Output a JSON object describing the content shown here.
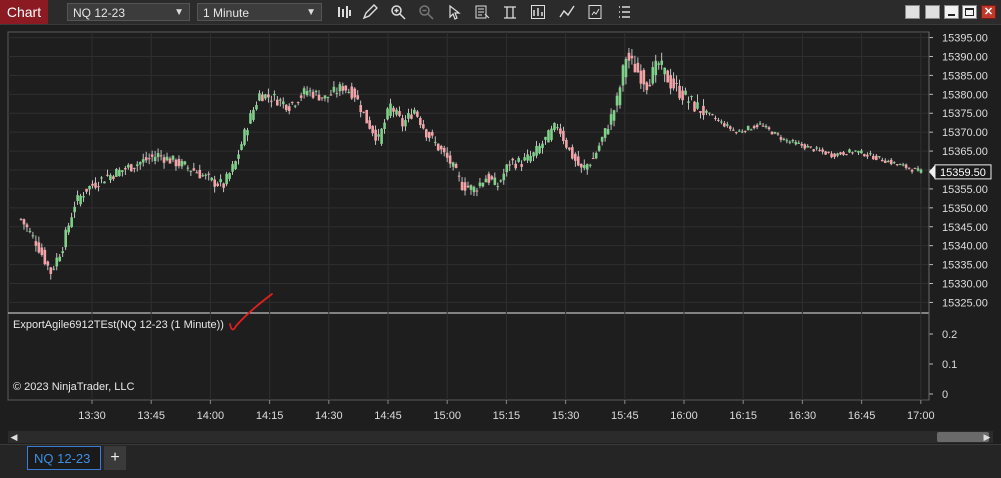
{
  "toolbar": {
    "title": "Chart",
    "instrument": "NQ 12-23",
    "interval": "1 Minute",
    "tools": [
      "bar-style-icon",
      "draw-pencil-icon",
      "zoom-in-icon",
      "zoom-out-icon",
      "pointer-icon",
      "data-box-icon",
      "template-icon",
      "strategies-icon",
      "indicators-icon",
      "properties-icon",
      "menu-icon"
    ]
  },
  "price_axis": {
    "current_price": "15359.50"
  },
  "indicator": {
    "label": "ExportAgile6912TEst(NQ 12-23 (1 Minute))",
    "copyright": "© 2023 NinjaTrader, LLC"
  },
  "tabs": {
    "active": "NQ 12-23",
    "add": "+"
  },
  "colors": {
    "background": "#1e1e1e",
    "up_candle": "#7fd18a",
    "down_candle": "#f2a3a8",
    "wick": "#e8e8e8",
    "accent": "#8b1a22",
    "annotation": "#e02020"
  },
  "chart_data": {
    "type": "candlestick",
    "y_ticks": [
      15395,
      15390,
      15385,
      15380,
      15375,
      15370,
      15365,
      15360,
      15355,
      15350,
      15345,
      15340,
      15335,
      15330,
      15325
    ],
    "ylim": [
      15323,
      15397
    ],
    "x_ticks": [
      "13:30",
      "13:45",
      "14:00",
      "14:15",
      "14:30",
      "14:45",
      "15:00",
      "15:15",
      "15:30",
      "15:45",
      "16:00",
      "16:15",
      "16:30",
      "16:45",
      "17:00"
    ],
    "indicator_ticks": [
      0.2,
      0.1,
      0
    ],
    "close_anchors": [
      [
        0,
        15347
      ],
      [
        5,
        15341
      ],
      [
        10,
        15333
      ],
      [
        14,
        15340
      ],
      [
        18,
        15351
      ],
      [
        22,
        15355
      ],
      [
        28,
        15358
      ],
      [
        34,
        15360
      ],
      [
        40,
        15362
      ],
      [
        46,
        15364
      ],
      [
        52,
        15362
      ],
      [
        58,
        15360
      ],
      [
        64,
        15357
      ],
      [
        68,
        15356
      ],
      [
        72,
        15362
      ],
      [
        76,
        15372
      ],
      [
        80,
        15380
      ],
      [
        85,
        15379
      ],
      [
        90,
        15377
      ],
      [
        96,
        15381
      ],
      [
        102,
        15379
      ],
      [
        108,
        15382
      ],
      [
        112,
        15380
      ],
      [
        116,
        15373
      ],
      [
        120,
        15368
      ],
      [
        124,
        15377
      ],
      [
        128,
        15372
      ],
      [
        132,
        15376
      ],
      [
        136,
        15370
      ],
      [
        140,
        15366
      ],
      [
        144,
        15362
      ],
      [
        148,
        15356
      ],
      [
        152,
        15355
      ],
      [
        156,
        15358
      ],
      [
        160,
        15356
      ],
      [
        164,
        15362
      ],
      [
        168,
        15362
      ],
      [
        172,
        15364
      ],
      [
        176,
        15368
      ],
      [
        180,
        15372
      ],
      [
        184,
        15365
      ],
      [
        188,
        15360
      ],
      [
        192,
        15363
      ],
      [
        196,
        15370
      ],
      [
        200,
        15378
      ],
      [
        203,
        15390
      ],
      [
        206,
        15387
      ],
      [
        210,
        15383
      ],
      [
        214,
        15388
      ],
      [
        218,
        15383
      ],
      [
        222,
        15380
      ],
      [
        226,
        15377
      ],
      [
        232,
        15374
      ],
      [
        240,
        15370
      ],
      [
        248,
        15372
      ],
      [
        256,
        15368
      ],
      [
        264,
        15366
      ],
      [
        272,
        15364
      ],
      [
        280,
        15365
      ],
      [
        288,
        15363
      ],
      [
        296,
        15361
      ],
      [
        302,
        15359.5
      ]
    ]
  }
}
